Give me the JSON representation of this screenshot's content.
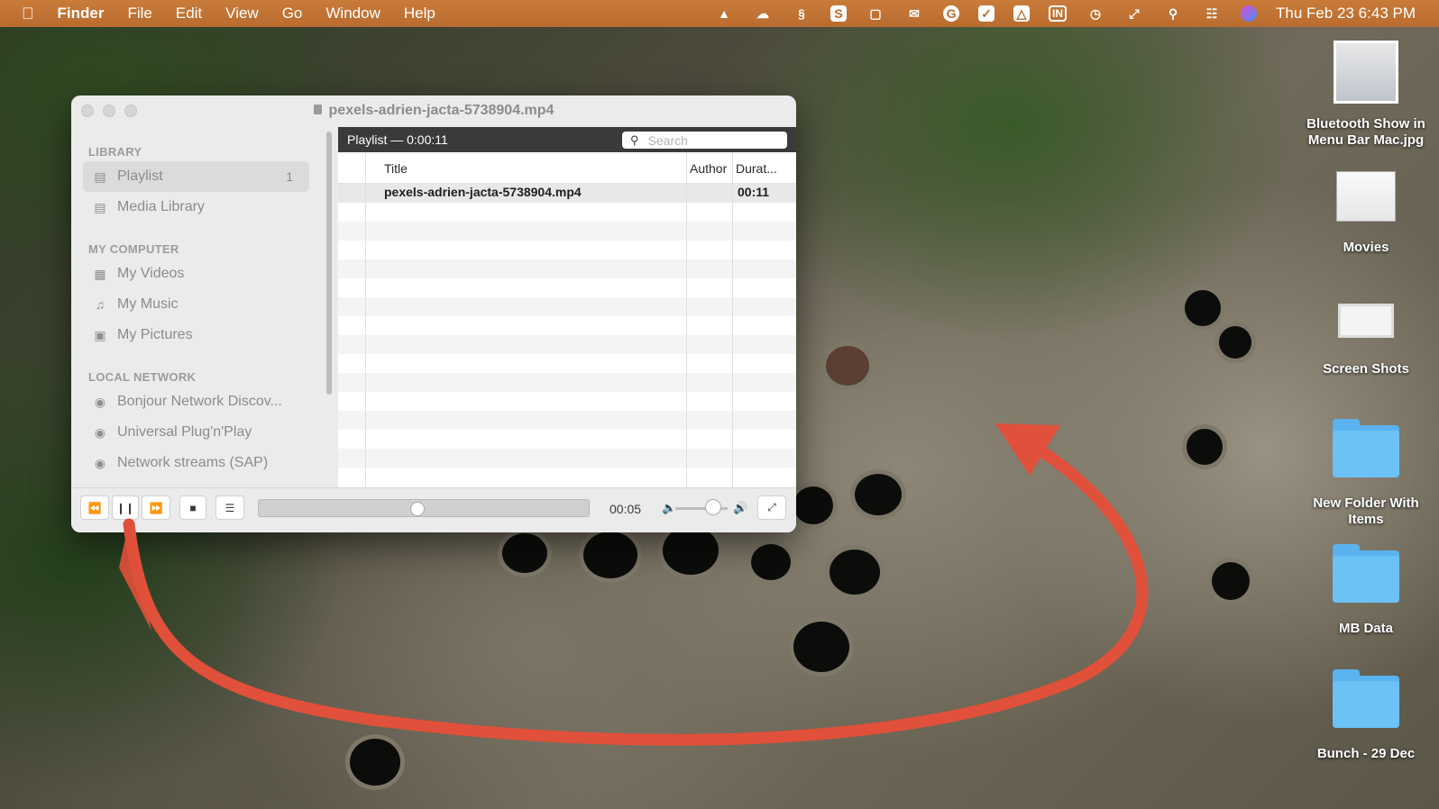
{
  "menubar": {
    "apple_icon": "apple-icon",
    "app": "Finder",
    "menus": [
      "File",
      "Edit",
      "View",
      "Go",
      "Window",
      "Help"
    ],
    "status_icons": [
      "vlc-icon",
      "cloud-icon",
      "scrivener-icon",
      "skype-icon",
      "screenshot-icon",
      "mail-icon",
      "grammarly-icon",
      "check-icon",
      "drive-icon",
      "input-icon",
      "time-machine-icon",
      "expand-icon",
      "search-icon",
      "control-center-icon",
      "siri-icon"
    ],
    "input_label": "IN",
    "skype_label": "S",
    "grammarly_label": "G",
    "clock": "Thu Feb 23  6:43 PM"
  },
  "window": {
    "title": "pexels-adrien-jacta-5738904.mp4",
    "sidebar": {
      "sections": [
        {
          "title": "LIBRARY",
          "items": [
            {
              "label": "Playlist",
              "icon": "playlist-icon",
              "count": "1",
              "selected": true
            },
            {
              "label": "Media Library",
              "icon": "media-library-icon"
            }
          ]
        },
        {
          "title": "MY COMPUTER",
          "items": [
            {
              "label": "My Videos",
              "icon": "film-icon"
            },
            {
              "label": "My Music",
              "icon": "music-note-icon"
            },
            {
              "label": "My Pictures",
              "icon": "picture-icon"
            }
          ]
        },
        {
          "title": "LOCAL NETWORK",
          "items": [
            {
              "label": "Bonjour Network Discov...",
              "icon": "network-icon"
            },
            {
              "label": "Universal Plug'n'Play",
              "icon": "network-icon"
            },
            {
              "label": "Network streams (SAP)",
              "icon": "network-icon"
            }
          ]
        }
      ]
    },
    "playlist": {
      "header": "Playlist — 0:00:11",
      "search_placeholder": "Search",
      "columns": {
        "title": "Title",
        "author": "Author",
        "duration": "Durat..."
      },
      "rows": [
        {
          "title": "pexels-adrien-jacta-5738904.mp4",
          "author": "",
          "duration": "00:11"
        }
      ]
    },
    "controls": {
      "time": "00:05",
      "progress": 0.48,
      "volume": 0.72
    }
  },
  "desktop": {
    "items": [
      {
        "label": "Bluetooth Show in Menu Bar Mac.jpg",
        "type": "image"
      },
      {
        "label": "Movies",
        "type": "image"
      },
      {
        "label": "Screen Shots",
        "type": "image"
      },
      {
        "label": "New Folder With Items",
        "type": "folder"
      },
      {
        "label": "MB Data",
        "type": "folder"
      },
      {
        "label": "Bunch - 29 Dec",
        "type": "folder"
      }
    ]
  },
  "colors": {
    "menubar": "#b96c2f",
    "arrow": "#e0503a",
    "folder": "#5ab3ee"
  }
}
